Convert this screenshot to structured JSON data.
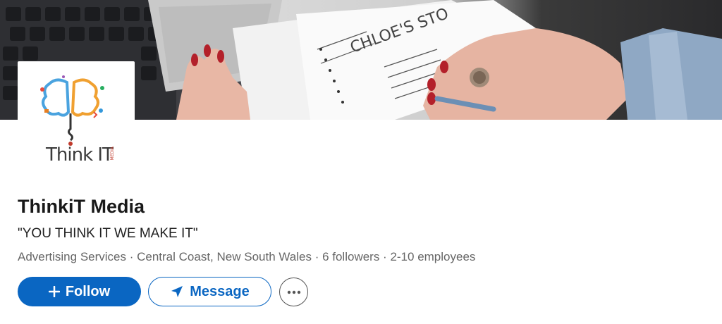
{
  "company": {
    "name": "ThinkiT Media",
    "tagline": "\"YOU THINK IT WE MAKE IT\"",
    "meta": "Advertising Services · Central Coast, New South Wales · 6 followers · 2-10 employees"
  },
  "logo": {
    "text": "Think IT",
    "tag": "MEDIA"
  },
  "cover": {
    "notepad_title": "CHLOE'S STO"
  },
  "actions": {
    "follow_label": "Follow",
    "message_label": "Message",
    "more_icon": "ellipsis-icon"
  },
  "colors": {
    "primary": "#0a66c2",
    "text": "#191919",
    "muted": "#666666"
  }
}
